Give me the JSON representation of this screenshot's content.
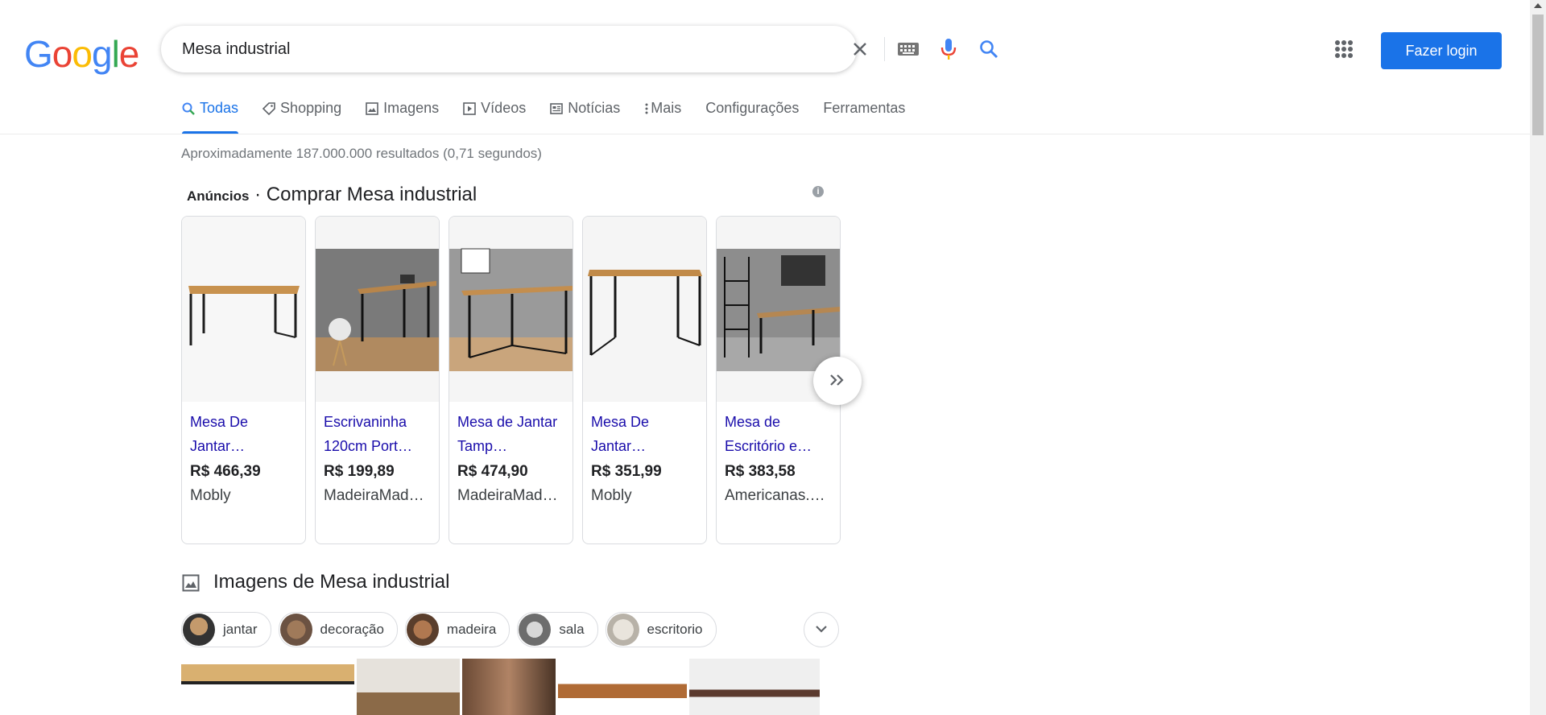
{
  "logo": [
    "G",
    "o",
    "o",
    "g",
    "l",
    "e"
  ],
  "logo_colors": [
    "#4285f4",
    "#ea4335",
    "#fbbc05",
    "#4285f4",
    "#34a853",
    "#ea4335"
  ],
  "search": {
    "query": "Mesa industrial"
  },
  "header": {
    "login_label": "Fazer login"
  },
  "tabs": [
    {
      "label": "Todas",
      "icon": "search-icon"
    },
    {
      "label": "Shopping",
      "icon": "tag-icon"
    },
    {
      "label": "Imagens",
      "icon": "image-icon"
    },
    {
      "label": "Vídeos",
      "icon": "play-icon"
    },
    {
      "label": "Notícias",
      "icon": "news-icon"
    },
    {
      "label": "Mais",
      "icon": "more-vert-icon"
    },
    {
      "label": "Configurações"
    },
    {
      "label": "Ferramentas"
    }
  ],
  "stats": "Aproximadamente 187.000.000 resultados (0,71 segundos)",
  "ads": {
    "prefix": "Anúncios",
    "separator": " · ",
    "title": "Comprar Mesa industrial",
    "products": [
      {
        "title": "Mesa De Jantar…",
        "price": "R$ 466,39",
        "store": "Mobly"
      },
      {
        "title": "Escrivaninha 120cm Port…",
        "price": "R$ 199,89",
        "store": "MadeiraMad…"
      },
      {
        "title": "Mesa de Jantar Tamp…",
        "price": "R$ 474,90",
        "store": "MadeiraMad…"
      },
      {
        "title": "Mesa De Jantar…",
        "price": "R$ 351,99",
        "store": "Mobly"
      },
      {
        "title": "Mesa de Escritório e…",
        "price": "R$ 383,58",
        "store": "Americanas.…"
      }
    ]
  },
  "images_section": {
    "title": "Imagens de Mesa industrial",
    "chips": [
      "jantar",
      "decoração",
      "madeira",
      "sala",
      "escritorio"
    ]
  },
  "colors": {
    "accent": "#1a73e8",
    "link": "#1a0dab"
  }
}
